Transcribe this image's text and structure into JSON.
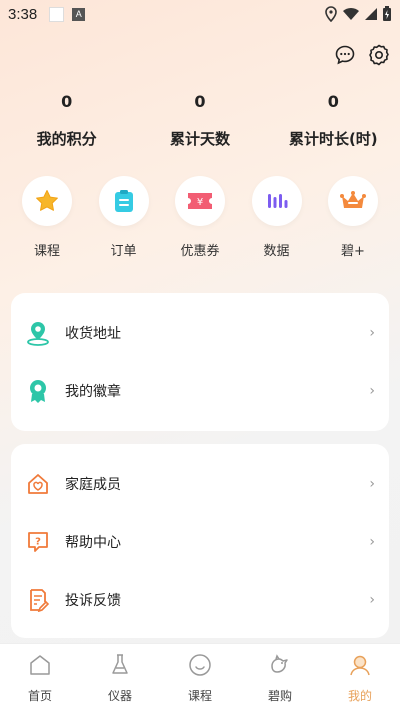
{
  "status_bar": {
    "time": "3:38"
  },
  "stats": [
    {
      "value": "0",
      "label": "我的积分"
    },
    {
      "value": "0",
      "label": "累计天数"
    },
    {
      "value": "0",
      "label": "累计时长(时)"
    }
  ],
  "quick_actions": [
    {
      "label": "课程",
      "icon": "star-icon"
    },
    {
      "label": "订单",
      "icon": "clipboard-icon"
    },
    {
      "label": "优惠券",
      "icon": "coupon-icon"
    },
    {
      "label": "数据",
      "icon": "bars-icon"
    },
    {
      "label": "碧+",
      "icon": "crown-icon"
    }
  ],
  "card1": [
    {
      "label": "收货地址",
      "icon": "location-icon"
    },
    {
      "label": "我的徽章",
      "icon": "badge-icon"
    }
  ],
  "card2": [
    {
      "label": "家庭成员",
      "icon": "home-icon"
    },
    {
      "label": "帮助中心",
      "icon": "help-icon"
    },
    {
      "label": "投诉反馈",
      "icon": "feedback-icon"
    }
  ],
  "chevron": "›",
  "tabs": [
    {
      "label": "首页",
      "icon": "home-tab-icon"
    },
    {
      "label": "仪器",
      "icon": "flask-icon"
    },
    {
      "label": "课程",
      "icon": "smile-icon"
    },
    {
      "label": "碧购",
      "icon": "bird-icon"
    },
    {
      "label": "我的",
      "icon": "user-icon",
      "active": true
    }
  ],
  "colors": {
    "accent": "#e8a15a",
    "teal": "#2dc6a8",
    "orange": "#f07a3a"
  }
}
